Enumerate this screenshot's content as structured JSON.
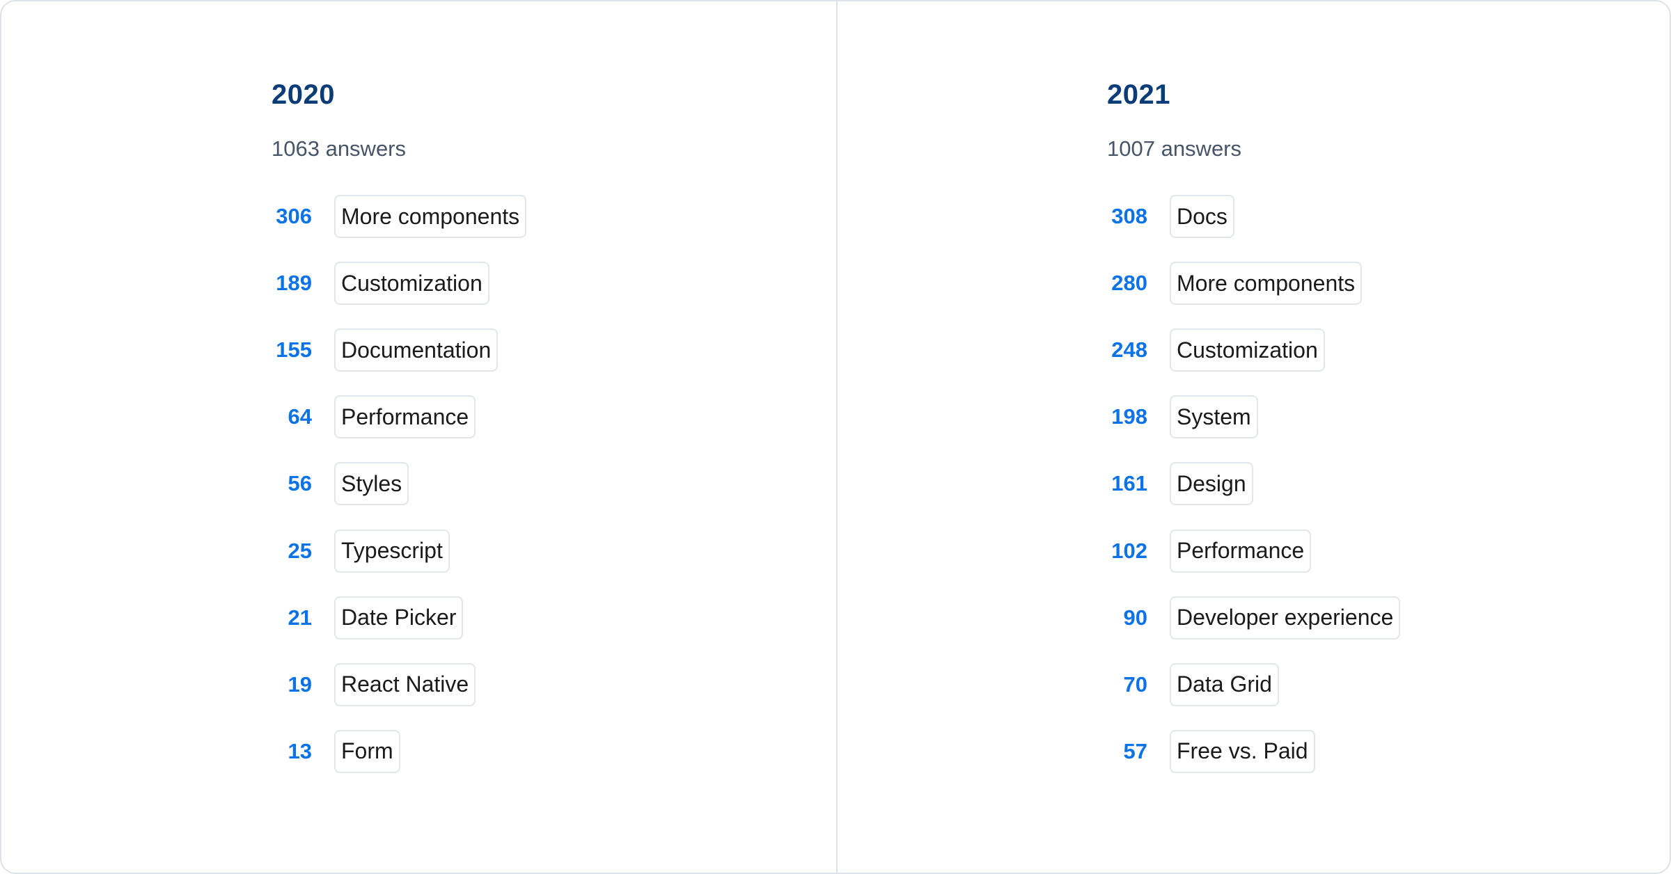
{
  "columns": [
    {
      "year": "2020",
      "answers": "1063 answers",
      "items": [
        {
          "count": "306",
          "label": "More components"
        },
        {
          "count": "189",
          "label": "Customization"
        },
        {
          "count": "155",
          "label": "Documentation"
        },
        {
          "count": "64",
          "label": "Performance"
        },
        {
          "count": "56",
          "label": "Styles"
        },
        {
          "count": "25",
          "label": "Typescript"
        },
        {
          "count": "21",
          "label": "Date Picker"
        },
        {
          "count": "19",
          "label": "React Native"
        },
        {
          "count": "13",
          "label": "Form"
        }
      ]
    },
    {
      "year": "2021",
      "answers": "1007 answers",
      "items": [
        {
          "count": "308",
          "label": "Docs"
        },
        {
          "count": "280",
          "label": "More components"
        },
        {
          "count": "248",
          "label": "Customization"
        },
        {
          "count": "198",
          "label": "System"
        },
        {
          "count": "161",
          "label": "Design"
        },
        {
          "count": "102",
          "label": "Performance"
        },
        {
          "count": "90",
          "label": "Developer experience"
        },
        {
          "count": "70",
          "label": "Data Grid"
        },
        {
          "count": "57",
          "label": "Free vs. Paid"
        }
      ]
    }
  ],
  "colors": {
    "heading": "#0a3d78",
    "count": "#0b72e7",
    "subtitle": "#475567",
    "border": "#dde2e8"
  }
}
